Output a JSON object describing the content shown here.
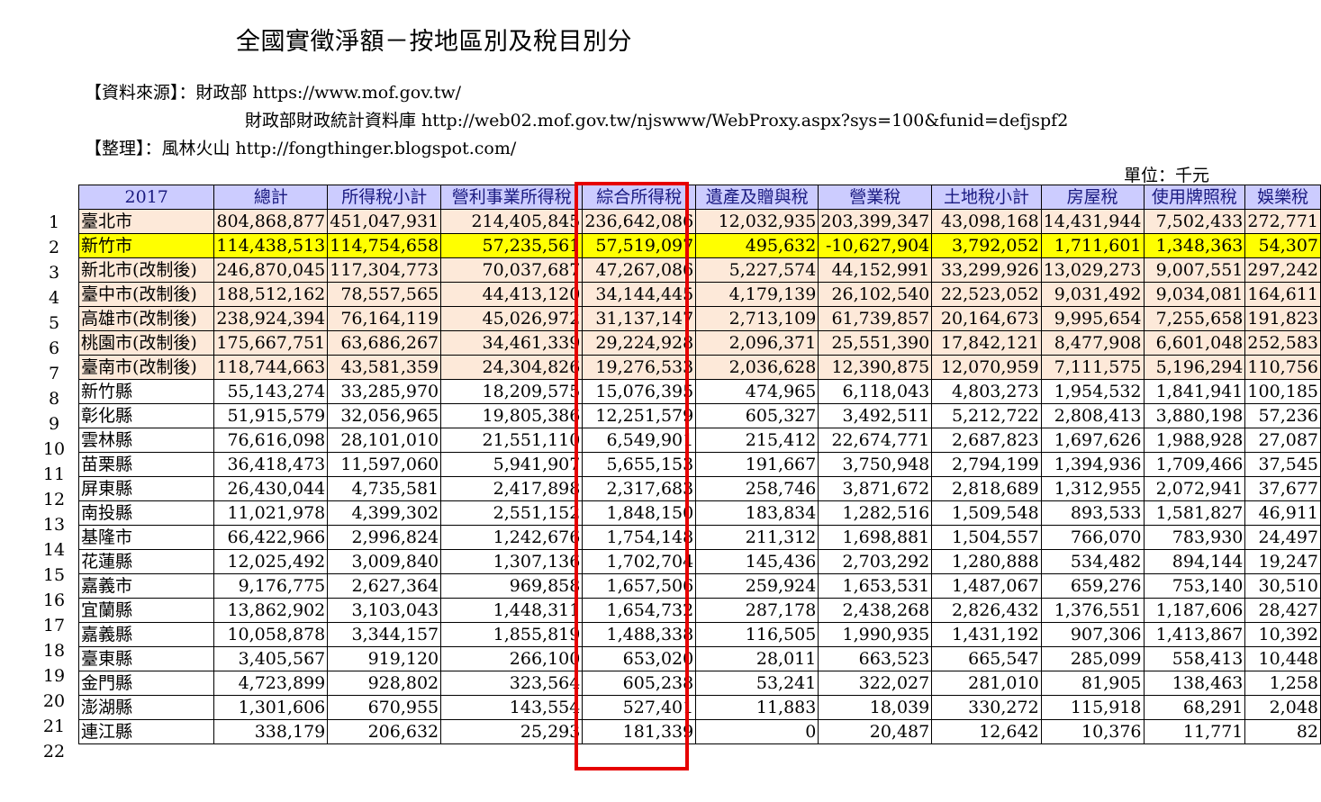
{
  "title": "全國實徵淨額－按地區別及稅目別分",
  "source": {
    "line1": "【資料來源】：財政部  https://www.mof.gov.tw/",
    "line2": "財政部財政統計資料庫  http://web02.mof.gov.tw/njswww/WebProxy.aspx?sys=100&funid=defjspf2",
    "line3": "【整理】：風林火山 http://fongthinger.blogspot.com/"
  },
  "unit": "單位：千元",
  "accent_colors": {
    "header_bg": "#ccccff",
    "city_row_bg": "#fde9d9",
    "highlight_row_bg": "#ffff00",
    "box": "#e60000"
  },
  "headers": [
    "2017",
    "總計",
    "所得稅小計",
    "營利事業所得稅",
    "綜合所得稅",
    "遺產及贈與稅",
    "營業稅",
    "土地稅小計",
    "房屋稅",
    "使用牌照稅",
    "娛樂稅"
  ],
  "rows": [
    {
      "n": "1",
      "kind": "city",
      "cells": [
        "臺北市",
        "804,868,877",
        "451,047,931",
        "214,405,845",
        "236,642,086",
        "12,032,935",
        "203,399,347",
        "43,098,168",
        "14,431,944",
        "7,502,433",
        "272,771"
      ]
    },
    {
      "n": "2",
      "kind": "hl",
      "cells": [
        "新竹市",
        "114,438,513",
        "114,754,658",
        "57,235,561",
        "57,519,097",
        "495,632",
        "-10,627,904",
        "3,792,052",
        "1,711,601",
        "1,348,363",
        "54,307"
      ]
    },
    {
      "n": "3",
      "kind": "city",
      "cells": [
        "新北市(改制後)",
        "246,870,045",
        "117,304,773",
        "70,037,687",
        "47,267,086",
        "5,227,574",
        "44,152,991",
        "33,299,926",
        "13,029,273",
        "9,007,551",
        "297,242"
      ]
    },
    {
      "n": "4",
      "kind": "city",
      "cells": [
        "臺中市(改制後)",
        "188,512,162",
        "78,557,565",
        "44,413,120",
        "34,144,445",
        "4,179,139",
        "26,102,540",
        "22,523,052",
        "9,031,492",
        "9,034,081",
        "164,611"
      ]
    },
    {
      "n": "5",
      "kind": "city",
      "cells": [
        "高雄市(改制後)",
        "238,924,394",
        "76,164,119",
        "45,026,972",
        "31,137,147",
        "2,713,109",
        "61,739,857",
        "20,164,673",
        "9,995,654",
        "7,255,658",
        "191,823"
      ]
    },
    {
      "n": "6",
      "kind": "city",
      "cells": [
        "桃園市(改制後)",
        "175,667,751",
        "63,686,267",
        "34,461,339",
        "29,224,928",
        "2,096,371",
        "25,551,390",
        "17,842,121",
        "8,477,908",
        "6,601,048",
        "252,583"
      ]
    },
    {
      "n": "7",
      "kind": "city",
      "cells": [
        "臺南市(改制後)",
        "118,744,663",
        "43,581,359",
        "24,304,826",
        "19,276,533",
        "2,036,628",
        "12,390,875",
        "12,070,959",
        "7,111,575",
        "5,196,294",
        "110,756"
      ]
    },
    {
      "n": "8",
      "kind": "plain",
      "cells": [
        "新竹縣",
        "55,143,274",
        "33,285,970",
        "18,209,575",
        "15,076,395",
        "474,965",
        "6,118,043",
        "4,803,273",
        "1,954,532",
        "1,841,941",
        "100,185"
      ]
    },
    {
      "n": "9",
      "kind": "plain",
      "cells": [
        "彰化縣",
        "51,915,579",
        "32,056,965",
        "19,805,386",
        "12,251,579",
        "605,327",
        "3,492,511",
        "5,212,722",
        "2,808,413",
        "3,880,198",
        "57,236"
      ]
    },
    {
      "n": "10",
      "kind": "plain",
      "cells": [
        "雲林縣",
        "76,616,098",
        "28,101,010",
        "21,551,110",
        "6,549,901",
        "215,412",
        "22,674,771",
        "2,687,823",
        "1,697,626",
        "1,988,928",
        "27,087"
      ]
    },
    {
      "n": "11",
      "kind": "plain",
      "cells": [
        "苗栗縣",
        "36,418,473",
        "11,597,060",
        "5,941,907",
        "5,655,153",
        "191,667",
        "3,750,948",
        "2,794,199",
        "1,394,936",
        "1,709,466",
        "37,545"
      ]
    },
    {
      "n": "12",
      "kind": "plain",
      "cells": [
        "屏東縣",
        "26,430,044",
        "4,735,581",
        "2,417,898",
        "2,317,683",
        "258,746",
        "3,871,672",
        "2,818,689",
        "1,312,955",
        "2,072,941",
        "37,677"
      ]
    },
    {
      "n": "13",
      "kind": "plain",
      "cells": [
        "南投縣",
        "11,021,978",
        "4,399,302",
        "2,551,152",
        "1,848,150",
        "183,834",
        "1,282,516",
        "1,509,548",
        "893,533",
        "1,581,827",
        "46,911"
      ]
    },
    {
      "n": "14",
      "kind": "plain",
      "cells": [
        "基隆市",
        "66,422,966",
        "2,996,824",
        "1,242,676",
        "1,754,148",
        "211,312",
        "1,698,881",
        "1,504,557",
        "766,070",
        "783,930",
        "24,497"
      ]
    },
    {
      "n": "15",
      "kind": "plain",
      "cells": [
        "花蓮縣",
        "12,025,492",
        "3,009,840",
        "1,307,136",
        "1,702,704",
        "145,436",
        "2,703,292",
        "1,280,888",
        "534,482",
        "894,144",
        "19,247"
      ]
    },
    {
      "n": "16",
      "kind": "plain",
      "cells": [
        "嘉義市",
        "9,176,775",
        "2,627,364",
        "969,858",
        "1,657,506",
        "259,924",
        "1,653,531",
        "1,487,067",
        "659,276",
        "753,140",
        "30,510"
      ]
    },
    {
      "n": "17",
      "kind": "plain",
      "cells": [
        "宜蘭縣",
        "13,862,902",
        "3,103,043",
        "1,448,311",
        "1,654,732",
        "287,178",
        "2,438,268",
        "2,826,432",
        "1,376,551",
        "1,187,606",
        "28,427"
      ]
    },
    {
      "n": "18",
      "kind": "plain",
      "cells": [
        "嘉義縣",
        "10,058,878",
        "3,344,157",
        "1,855,819",
        "1,488,338",
        "116,505",
        "1,990,935",
        "1,431,192",
        "907,306",
        "1,413,867",
        "10,392"
      ]
    },
    {
      "n": "19",
      "kind": "plain",
      "cells": [
        "臺東縣",
        "3,405,567",
        "919,120",
        "266,100",
        "653,020",
        "28,011",
        "663,523",
        "665,547",
        "285,099",
        "558,413",
        "10,448"
      ]
    },
    {
      "n": "20",
      "kind": "plain",
      "cells": [
        "金門縣",
        "4,723,899",
        "928,802",
        "323,564",
        "605,238",
        "53,241",
        "322,027",
        "281,010",
        "81,905",
        "138,463",
        "1,258"
      ]
    },
    {
      "n": "21",
      "kind": "plain",
      "cells": [
        "澎湖縣",
        "1,301,606",
        "670,955",
        "143,554",
        "527,401",
        "11,883",
        "18,039",
        "330,272",
        "115,918",
        "68,291",
        "2,048"
      ]
    },
    {
      "n": "22",
      "kind": "plain",
      "cells": [
        "連江縣",
        "338,179",
        "206,632",
        "25,293",
        "181,339",
        "0",
        "20,487",
        "12,642",
        "10,376",
        "11,771",
        "82"
      ]
    }
  ]
}
